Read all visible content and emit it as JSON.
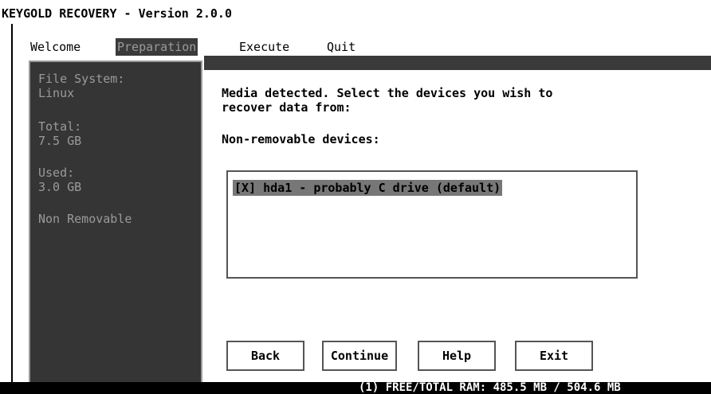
{
  "app": {
    "title": "KEYGOLD RECOVERY - Version 2.0.0"
  },
  "menu": {
    "items": [
      {
        "label": "Welcome"
      },
      {
        "label": "Preparation"
      },
      {
        "label": "Execute"
      },
      {
        "label": "Quit"
      }
    ],
    "active": "Preparation"
  },
  "sidebar": {
    "file_system_label": "File System:",
    "file_system_value": "Linux",
    "total_label": "Total:",
    "total_value": "7.5 GB",
    "used_label": "Used:",
    "used_value": "3.0 GB",
    "type_value": "Non Removable"
  },
  "main": {
    "intro_line1": "Media detected. Select the devices you wish to",
    "intro_line2": "recover data from:",
    "section_label": "Non-removable devices:",
    "devices": [
      {
        "label": "[X] hda1 - probably C drive (default)",
        "checked": true
      }
    ]
  },
  "buttons": {
    "back": "Back",
    "continue": "Continue",
    "help": "Help",
    "exit": "Exit"
  },
  "status": {
    "text": "(1)  FREE/TOTAL RAM: 485.5 MB / 504.6 MB"
  },
  "colors": {
    "panel": "#353535",
    "muted_text": "#9a9a9a",
    "highlight": "#777777"
  }
}
